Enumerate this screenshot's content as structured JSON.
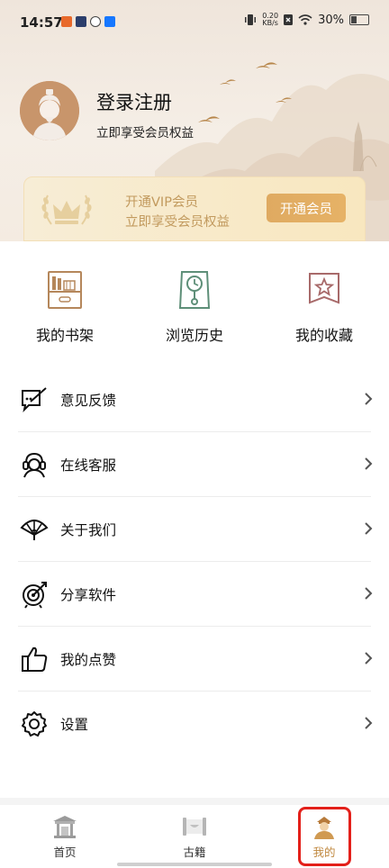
{
  "status_bar": {
    "time": "14:57",
    "net_speed_value": "0.20",
    "net_speed_unit": "KB/s",
    "battery": "30%"
  },
  "profile": {
    "title": "登录注册",
    "subtitle": "立即享受会员权益"
  },
  "vip": {
    "title": "开通VIP会员",
    "subtitle": "立即享受会员权益",
    "button": "开通会员"
  },
  "quick_actions": [
    {
      "label": "我的书架",
      "icon": "bookshelf-icon"
    },
    {
      "label": "浏览历史",
      "icon": "clock-history-icon"
    },
    {
      "label": "我的收藏",
      "icon": "star-bookmark-icon"
    }
  ],
  "menu": [
    {
      "label": "意见反馈",
      "icon": "feedback-icon"
    },
    {
      "label": "在线客服",
      "icon": "customer-service-icon"
    },
    {
      "label": "关于我们",
      "icon": "fan-icon"
    },
    {
      "label": "分享软件",
      "icon": "target-share-icon"
    },
    {
      "label": "我的点赞",
      "icon": "thumbs-up-icon"
    },
    {
      "label": "设置",
      "icon": "settings-gear-icon"
    }
  ],
  "bottom_nav": [
    {
      "label": "首页",
      "icon": "temple-home-icon"
    },
    {
      "label": "古籍",
      "icon": "scroll-book-icon"
    },
    {
      "label": "我的",
      "icon": "scholar-avatar-icon",
      "active": true
    }
  ],
  "colors": {
    "accent": "#c0883f",
    "vip_button": "#e0a95f",
    "highlight": "#e3201a"
  }
}
